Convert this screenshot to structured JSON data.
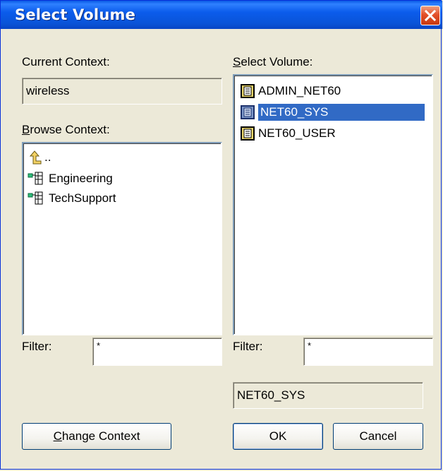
{
  "window": {
    "title": "Select Volume"
  },
  "current_context": {
    "label": "Current Context:",
    "value": "wireless"
  },
  "browse_context": {
    "label_accel": "B",
    "label_rest": "rowse Context:",
    "items": [
      {
        "label": "..",
        "icon": "up-arrow-icon"
      },
      {
        "label": "Engineering",
        "icon": "organization-icon"
      },
      {
        "label": "TechSupport",
        "icon": "organization-icon"
      }
    ],
    "filter_label": "Filter:",
    "filter_value": "*"
  },
  "select_volume": {
    "label_accel": "S",
    "label_rest": "elect Volume:",
    "items": [
      {
        "label": "ADMIN_NET60",
        "icon": "volume-icon",
        "selected": false
      },
      {
        "label": "NET60_SYS",
        "icon": "volume-icon",
        "selected": true
      },
      {
        "label": "NET60_USER",
        "icon": "volume-icon",
        "selected": false
      }
    ],
    "filter_label": "Filter:",
    "filter_value": "*",
    "selection_value": "NET60_SYS"
  },
  "buttons": {
    "change_context_accel": "C",
    "change_context_rest": "hange Context",
    "ok": "OK",
    "cancel": "Cancel"
  },
  "colors": {
    "title_bar": "#0a54d8",
    "selection": "#316ac5",
    "dialog_bg": "#ece9d8"
  }
}
